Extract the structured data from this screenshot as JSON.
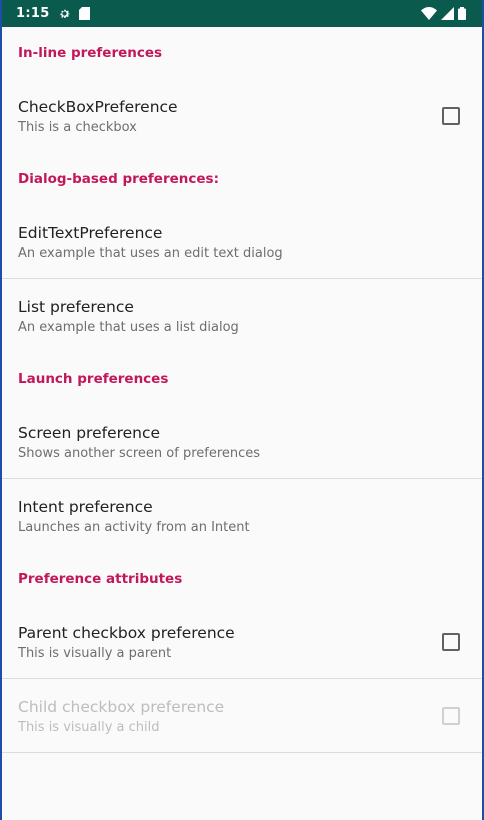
{
  "status_bar": {
    "time": "1:15",
    "left_icons": [
      "settings-icon",
      "sd-card-icon"
    ],
    "right_icons": [
      "wifi-icon",
      "signal-icon",
      "battery-icon"
    ]
  },
  "sections": [
    {
      "category": "In-line preferences",
      "items": [
        {
          "title": "CheckBoxPreference",
          "summary": "This is a checkbox",
          "checkbox": true,
          "enabled": true
        }
      ]
    },
    {
      "category": "Dialog-based preferences:",
      "items": [
        {
          "title": "EditTextPreference",
          "summary": "An example that uses an edit text dialog"
        },
        {
          "title": "List preference",
          "summary": "An example that uses a list dialog"
        }
      ]
    },
    {
      "category": "Launch preferences",
      "items": [
        {
          "title": "Screen preference",
          "summary": "Shows another screen of preferences"
        },
        {
          "title": "Intent preference",
          "summary": "Launches an activity from an Intent"
        }
      ]
    },
    {
      "category": "Preference attributes",
      "items": [
        {
          "title": "Parent checkbox preference",
          "summary": "This is visually a parent",
          "checkbox": true,
          "enabled": true
        },
        {
          "title": "Child checkbox preference",
          "summary": "This is visually a child",
          "checkbox": true,
          "enabled": false
        }
      ]
    }
  ],
  "colors": {
    "status_bar": "#0b5a4e",
    "category_accent": "#c2185b",
    "background": "#fafafa"
  }
}
